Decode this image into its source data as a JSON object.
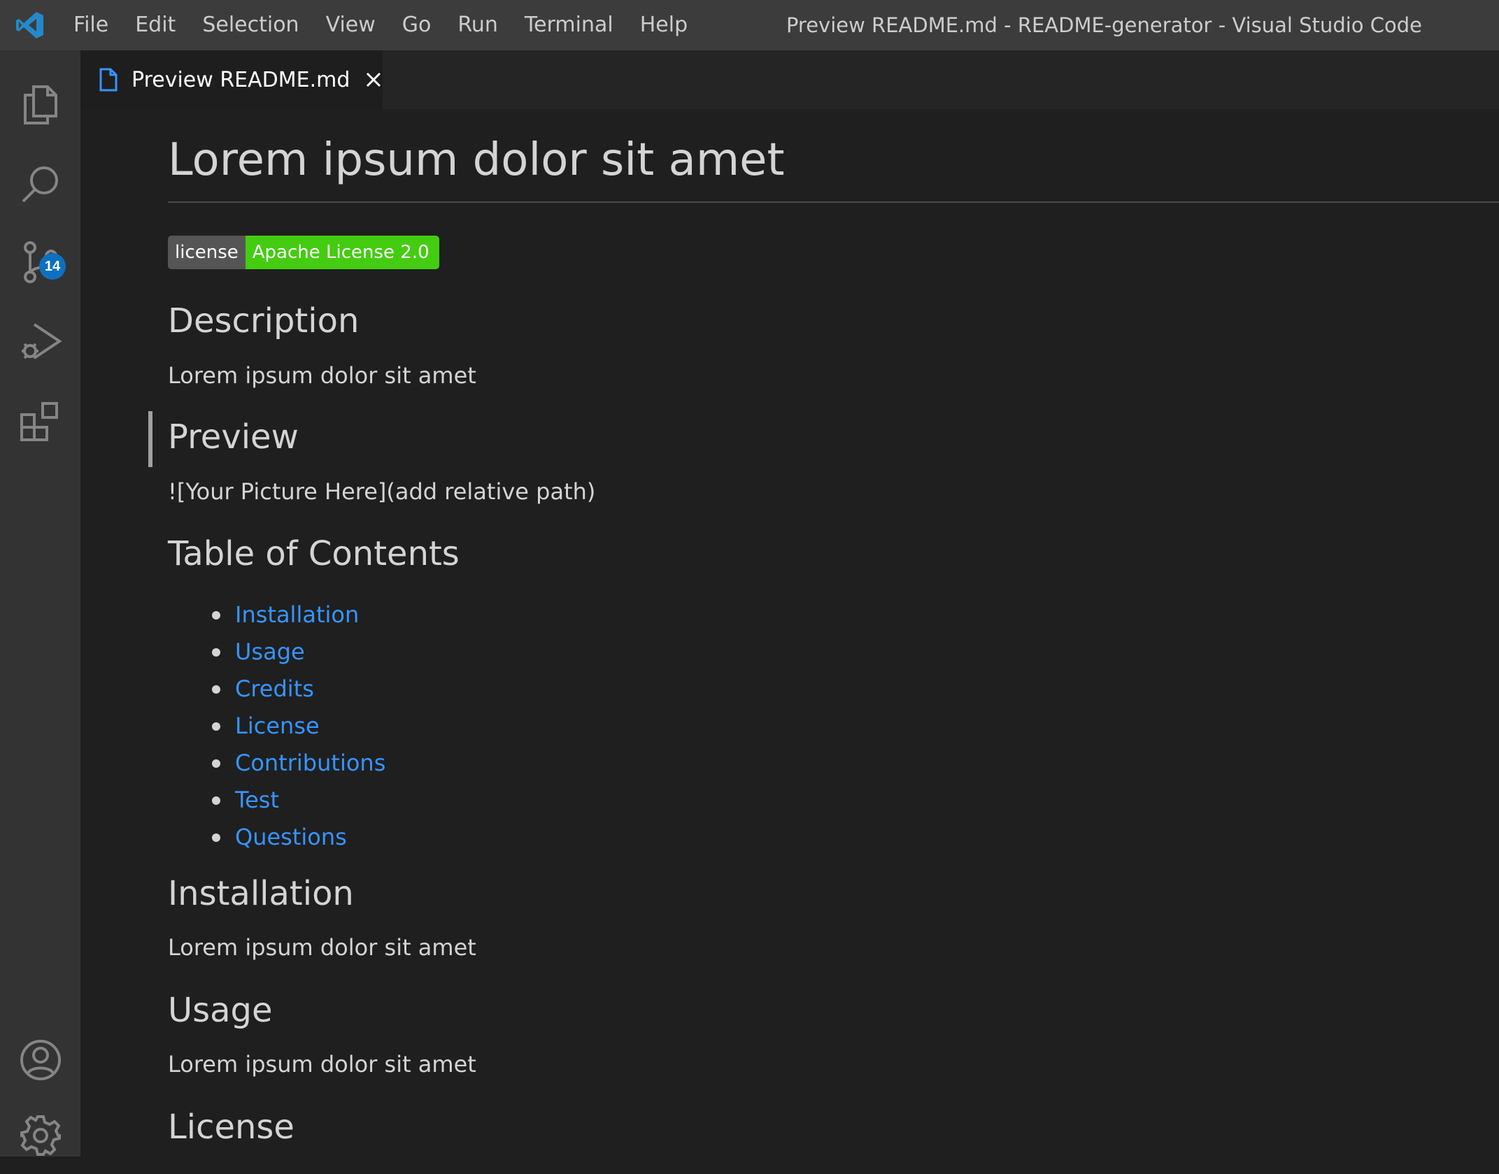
{
  "window": {
    "title": "Preview README.md - README-generator - Visual Studio Code"
  },
  "menu": [
    "File",
    "Edit",
    "Selection",
    "View",
    "Go",
    "Run",
    "Terminal",
    "Help"
  ],
  "activity": {
    "items": [
      "explorer-icon",
      "search-icon",
      "source-control-icon",
      "run-debug-icon",
      "extensions-icon"
    ],
    "source_control_badge": "14",
    "bottom": [
      "accounts-icon",
      "manage-gear-icon"
    ]
  },
  "tab": {
    "label": "Preview README.md",
    "icon": "markdown-file-icon"
  },
  "colors": {
    "accent": "#0e70c0",
    "link": "#3794ff",
    "badge_green": "#44cc11",
    "badge_gray": "#555555"
  },
  "doc": {
    "title": "Lorem ipsum dolor sit amet",
    "badge": {
      "label": "license",
      "value": "Apache License 2.0"
    },
    "description_heading": "Description",
    "description_text": "Lorem ipsum dolor sit amet",
    "preview_heading": "Preview",
    "preview_text": "![Your Picture Here](add relative path)",
    "toc_heading": "Table of Contents",
    "toc": [
      "Installation",
      "Usage",
      "Credits",
      "License",
      "Contributions",
      "Test",
      "Questions"
    ],
    "installation_heading": "Installation",
    "installation_text": "Lorem ipsum dolor sit amet",
    "usage_heading": "Usage",
    "usage_text": "Lorem ipsum dolor sit amet",
    "license_heading": "License"
  }
}
